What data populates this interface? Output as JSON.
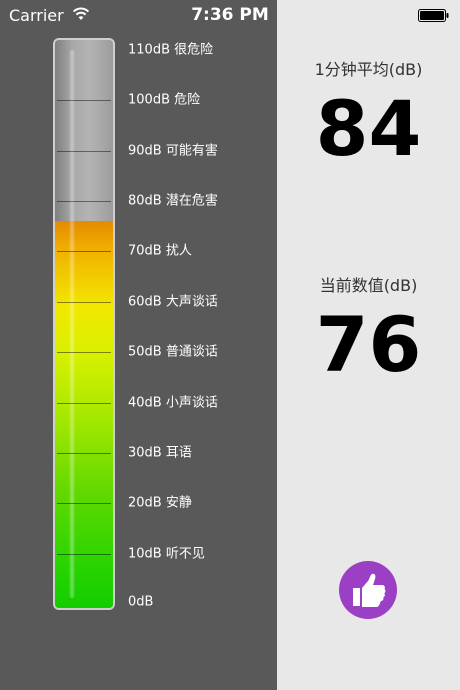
{
  "status_bar": {
    "carrier": "Carrier",
    "time": "7:36 PM"
  },
  "meter": {
    "current_db": 76,
    "max_db": 110,
    "scale": [
      {
        "db": 110,
        "label": "110dB 很危险"
      },
      {
        "db": 100,
        "label": "100dB 危险"
      },
      {
        "db": 90,
        "label": "90dB 可能有害"
      },
      {
        "db": 80,
        "label": "80dB 潜在危害"
      },
      {
        "db": 70,
        "label": "70dB 扰人"
      },
      {
        "db": 60,
        "label": "60dB 大声谈话"
      },
      {
        "db": 50,
        "label": "50dB 普通谈话"
      },
      {
        "db": 40,
        "label": "40dB 小声谈话"
      },
      {
        "db": 30,
        "label": "30dB 耳语"
      },
      {
        "db": 20,
        "label": "20dB 安静"
      },
      {
        "db": 10,
        "label": "10dB 听不见"
      },
      {
        "db": 0,
        "label": "0dB"
      }
    ]
  },
  "summary": {
    "avg_title": "1分钟平均(dB)",
    "avg_value": "84",
    "current_title": "当前数值(dB)",
    "current_value": "76"
  },
  "colors": {
    "left_bg": "#595959",
    "right_bg": "#e8e8e8",
    "thumb_bg": "#9b3fc4"
  },
  "icons": {
    "thumb_button": "thumbs-up-icon"
  }
}
